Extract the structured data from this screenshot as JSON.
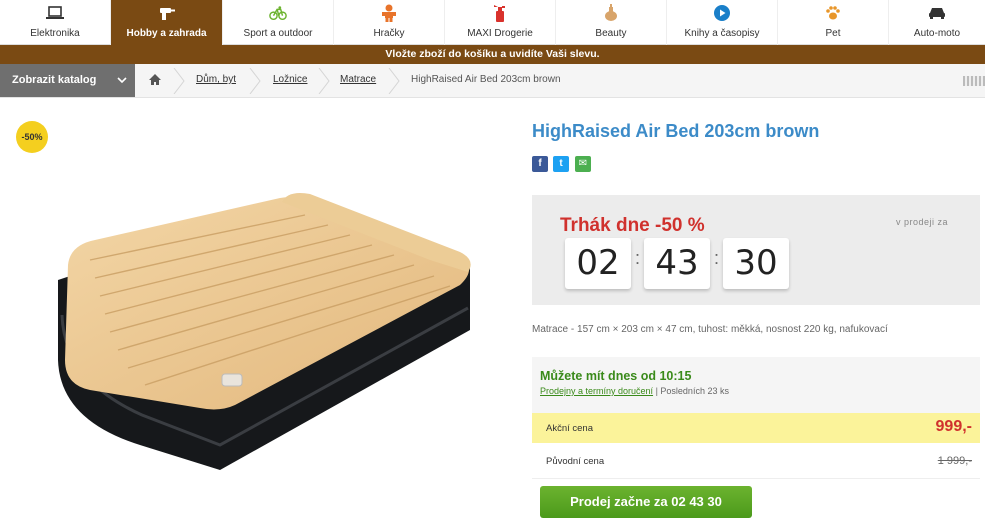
{
  "categories": [
    {
      "label": "Elektronika",
      "icon": "laptop-icon"
    },
    {
      "label": "Hobby a zahrada",
      "icon": "drill-icon",
      "active": true
    },
    {
      "label": "Sport a outdoor",
      "icon": "bicycle-icon"
    },
    {
      "label": "Hračky",
      "icon": "toy-figure-icon"
    },
    {
      "label": "MAXI Drogerie",
      "icon": "spray-bottle-icon"
    },
    {
      "label": "Beauty",
      "icon": "cosmetics-icon"
    },
    {
      "label": "Knihy a časopisy",
      "icon": "play-circle-icon"
    },
    {
      "label": "Pet",
      "icon": "paw-icon"
    },
    {
      "label": "Auto-moto",
      "icon": "car-icon"
    }
  ],
  "promo_text": "Vložte zboží do košíku a uvidíte Vaši slevu.",
  "breadcrumb": {
    "catalog_button": "Zobrazit katalog",
    "items": [
      "Dům, byt",
      "Ložnice",
      "Matrace"
    ],
    "current": "HighRaised Air Bed 203cm brown"
  },
  "product": {
    "discount_badge": "-50%",
    "title": "HighRaised Air Bed 203cm brown",
    "description": "Matrace - 157 cm × 203 cm × 47 cm, tuhost: měkká, nosnost 220 kg, nafukovací"
  },
  "share": {
    "facebook": "f",
    "twitter": "t",
    "email": "✉"
  },
  "deal": {
    "title": "Trhák dne -50 %",
    "side_text": "v prodeji za",
    "hours": "02",
    "minutes": "43",
    "seconds": "30"
  },
  "availability": {
    "title": "Můžete mít dnes od 10:15",
    "link": "Prodejny a termíny doručení",
    "stock_text": "| Posledních 23 ks"
  },
  "prices": {
    "sale_label": "Akční cena",
    "sale_value": "999,-",
    "original_label": "Původní cena",
    "original_value": "1 999,-"
  },
  "sale_button": "Prodej začne za 02 43 30",
  "colors": {
    "brand_brown": "#7a4a13",
    "title_blue": "#3c8bc8",
    "deal_red": "#d0312d",
    "green": "#4b9a1b",
    "yellow": "#f4cf1f"
  }
}
